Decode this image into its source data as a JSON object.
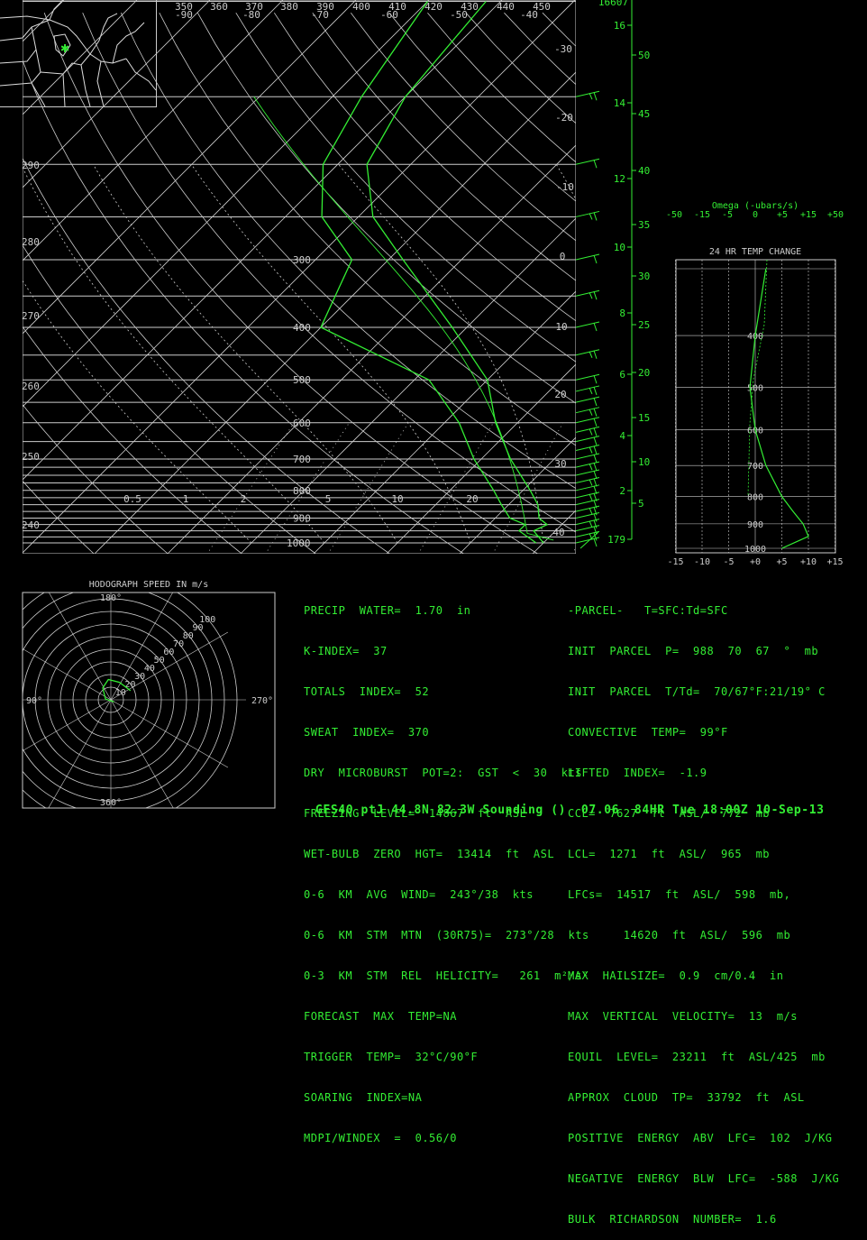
{
  "header_theta_labels": [
    "350",
    "360",
    "370",
    "380",
    "390",
    "400",
    "410",
    "420",
    "430",
    "440",
    "450"
  ],
  "header_temp_labels": [
    "-90",
    "-80",
    "-70",
    "-60",
    "-50",
    "-40"
  ],
  "theta_side_labels": [
    "290",
    "280",
    "270",
    "260",
    "250",
    "240"
  ],
  "pressure_labels": [
    "300",
    "400",
    "500",
    "600",
    "700",
    "800",
    "900",
    "1000"
  ],
  "mixing_ratio_labels": [
    "0.5",
    "1",
    "2",
    "5",
    "10",
    "20"
  ],
  "temp_right_labels": [
    "-30",
    "-20",
    "-10",
    "0",
    "10",
    "20",
    "30",
    "40"
  ],
  "height_axis": {
    "top_label": "16607",
    "km_labels": [
      "16",
      "14",
      "12",
      "10",
      "8",
      "6",
      "4",
      "2",
      "179"
    ],
    "kft_labels": [
      "50",
      "45",
      "40",
      "35",
      "30",
      "25",
      "20",
      "15",
      "10",
      "5"
    ]
  },
  "omega_panel": {
    "title": "Omega (-ubars/s)",
    "scale": [
      "-50",
      "-15",
      "-5",
      "0",
      "+5",
      "+15",
      "+50"
    ]
  },
  "temp_change_panel": {
    "title": "24 HR TEMP CHANGE",
    "pressure_labels": [
      "400",
      "500",
      "600",
      "700",
      "800",
      "900",
      "1000"
    ],
    "x_labels": [
      "-15",
      "-10",
      "-5",
      "+0",
      "+5",
      "+10",
      "+15"
    ]
  },
  "hodograph": {
    "title": "HODOGRAPH SPEED IN m/s",
    "deg_labels": {
      "top": "180°",
      "left": "90°",
      "right": "270°",
      "bottom": "360°"
    },
    "ring_labels": [
      "10",
      "20",
      "30",
      "40",
      "50",
      "60",
      "70",
      "80",
      "90",
      "100"
    ]
  },
  "stats_left": [
    "PRECIP  WATER=  1.70  in",
    "K-INDEX=  37",
    "TOTALS  INDEX=  52",
    "SWEAT  INDEX=  370",
    "DRY  MICROBURST  POT=2:  GST  <  30  kts",
    "FREEZING  LEVEL=  14867  ft  ASL",
    "WET-BULB  ZERO  HGT=  13414  ft  ASL",
    "0-6  KM  AVG  WIND=  243°/38  kts",
    "0-6  KM  STM  MTN  (30R75)=  273°/28  kts",
    "0-3  KM  STM  REL  HELICITY=   261  m²/s²",
    "FORECAST  MAX  TEMP=NA",
    "TRIGGER  TEMP=  32°C/90°F",
    "SOARING  INDEX=NA",
    "MDPI/WINDEX  =  0.56/0"
  ],
  "stats_right": [
    "-PARCEL-   T=SFC:Td=SFC",
    "INIT  PARCEL  P=  988  70  67  °  mb",
    "INIT  PARCEL  T/Td=  70/67°F:21/19° C",
    "CONVECTIVE  TEMP=  99°F",
    "LIFTED  INDEX=  -1.9",
    "CCL=  7627  ft  ASL/  772  mb",
    "LCL=  1271  ft  ASL/  965  mb",
    "LFCs=  14517  ft  ASL/  598  mb,",
    "        14620  ft  ASL/  596  mb",
    "MAX  HAILSIZE=  0.9  cm/0.4  in",
    "MAX  VERTICAL  VELOCITY=  13  m/s",
    "EQUIL  LEVEL=  23211  ft  ASL/425  mb",
    "APPROX  CLOUD  TP=  33792  ft  ASL",
    "POSITIVE  ENERGY  ABV  LFC=  102  J/KG",
    "NEGATIVE  ENERGY  BLW  LFC=  -588  J/KG",
    "BULK  RICHARDSON  NUMBER=  1.6"
  ],
  "footer": "GFS40 ptJ 44.8N 82.3W Sounding ()  07.06  84HR Tue 18:00Z 10-Sep-13",
  "colors": {
    "trace": "#33ee33",
    "grid": "#cccccc",
    "background": "#000000"
  },
  "chart_data": {
    "type": "skew-t",
    "temperature_profile": [
      {
        "p": 1000,
        "t": 20
      },
      {
        "p": 950,
        "t": 17
      },
      {
        "p": 925,
        "t": 18
      },
      {
        "p": 900,
        "t": 16
      },
      {
        "p": 850,
        "t": 14
      },
      {
        "p": 800,
        "t": 11
      },
      {
        "p": 700,
        "t": 4
      },
      {
        "p": 600,
        "t": -3
      },
      {
        "p": 500,
        "t": -10
      },
      {
        "p": 400,
        "t": -22
      },
      {
        "p": 300,
        "t": -38
      },
      {
        "p": 250,
        "t": -48
      },
      {
        "p": 200,
        "t": -56
      },
      {
        "p": 150,
        "t": -60
      },
      {
        "p": 100,
        "t": -62
      }
    ],
    "dewpoint_profile": [
      {
        "p": 1000,
        "t": 19
      },
      {
        "p": 950,
        "t": 15
      },
      {
        "p": 925,
        "t": 15
      },
      {
        "p": 900,
        "t": 12
      },
      {
        "p": 850,
        "t": 9
      },
      {
        "p": 800,
        "t": 6
      },
      {
        "p": 700,
        "t": -1
      },
      {
        "p": 600,
        "t": -8
      },
      {
        "p": 500,
        "t": -18
      },
      {
        "p": 400,
        "t": -40
      },
      {
        "p": 300,
        "t": -45
      },
      {
        "p": 250,
        "t": -55
      },
      {
        "p": 200,
        "t": -62
      },
      {
        "p": 150,
        "t": -66
      },
      {
        "p": 100,
        "t": -70
      }
    ],
    "temp_change_24hr": [
      {
        "p": 1000,
        "dt": 5
      },
      {
        "p": 950,
        "dt": 10
      },
      {
        "p": 900,
        "dt": 9
      },
      {
        "p": 850,
        "dt": 7
      },
      {
        "p": 800,
        "dt": 5
      },
      {
        "p": 700,
        "dt": 2
      },
      {
        "p": 600,
        "dt": 0
      },
      {
        "p": 500,
        "dt": -1
      },
      {
        "p": 400,
        "dt": 0
      },
      {
        "p": 300,
        "dt": 2
      }
    ],
    "hodograph_uv": [
      {
        "u": -2,
        "v": 2
      },
      {
        "u": -6,
        "v": 5
      },
      {
        "u": -10,
        "v": 6
      },
      {
        "u": -12,
        "v": 3
      },
      {
        "u": -11,
        "v": -1
      },
      {
        "u": -8,
        "v": -2
      }
    ],
    "axis": {
      "pressure_range": [
        1050,
        100
      ],
      "temperature_range_at_1000": [
        -40,
        40
      ]
    }
  }
}
